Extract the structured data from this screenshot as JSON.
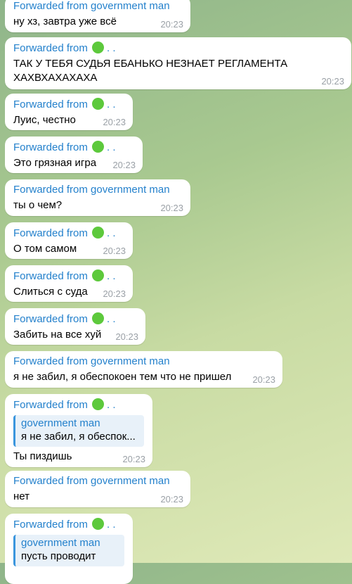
{
  "messages": [
    {
      "forward_from": "government man",
      "has_emoji": false,
      "text": "ну хз, завтра уже всё",
      "time": "20:23"
    },
    {
      "forward_from": ". .",
      "has_emoji": true,
      "text": "ТАК У ТЕБЯ СУДЬЯ ЕБАНЬКО НЕЗНАЕТ РЕГЛАМЕНТА ХАХВХАХАХАХА",
      "time": "20:23"
    },
    {
      "forward_from": ". .",
      "has_emoji": true,
      "text": "Луис, честно",
      "time": "20:23"
    },
    {
      "forward_from": ". .",
      "has_emoji": true,
      "text": "Это грязная игра",
      "time": "20:23"
    },
    {
      "forward_from": "government man",
      "has_emoji": false,
      "text": "ты о чем?",
      "time": "20:23"
    },
    {
      "forward_from": ". .",
      "has_emoji": true,
      "text": "О том самом",
      "time": "20:23"
    },
    {
      "forward_from": ". .",
      "has_emoji": true,
      "text": "Слиться с суда",
      "time": "20:23"
    },
    {
      "forward_from": ". .",
      "has_emoji": true,
      "text": "Забить на все хуй",
      "time": "20:23"
    },
    {
      "forward_from": "government man",
      "has_emoji": false,
      "text": "я не забил, я обеспокоен тем что не пришел",
      "time": "20:23"
    },
    {
      "forward_from": ". .",
      "has_emoji": true,
      "reply_name": "government man",
      "reply_text": "я не забил, я обеспок...",
      "text": "Ты пиздишь",
      "time": "20:23"
    },
    {
      "forward_from": "government man",
      "has_emoji": false,
      "text": "нет",
      "time": "20:23"
    },
    {
      "forward_from": ". .",
      "has_emoji": true,
      "reply_name": "government man",
      "reply_text": "пусть проводит",
      "text": "",
      "time": ""
    }
  ],
  "forward_prefix": "Forwarded from",
  "emoji": "green-circle"
}
